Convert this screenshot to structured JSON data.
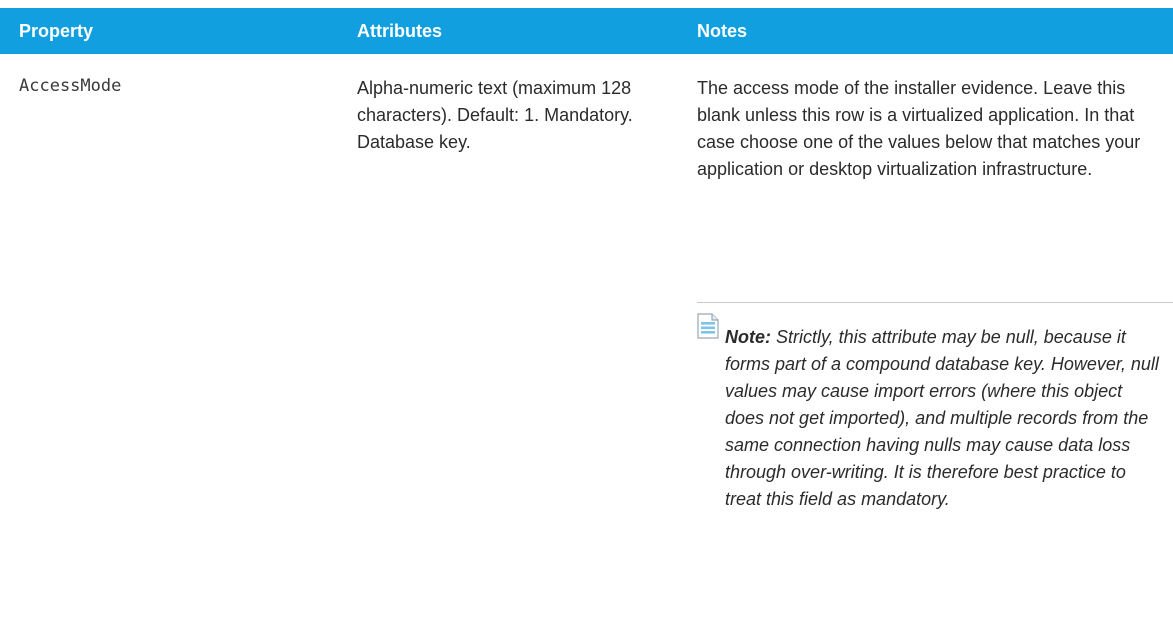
{
  "table": {
    "headers": {
      "property": "Property",
      "attributes": "Attributes",
      "notes": "Notes"
    },
    "rows": [
      {
        "property": "AccessMode",
        "attributes": "Alpha-numeric text (maximum 128 characters). Default: 1. Mandatory. Database key.",
        "notes": "The access mode of the installer evidence. Leave this blank unless this row is a virtualized application. In that case choose one of the values below that matches your application or desktop virtualization infrastructure.",
        "note": {
          "icon": "note-document-icon",
          "label": "Note:",
          "text": "Strictly, this attribute may be null, because it forms part of a compound database key. However, null values may cause import errors (where this object does not get imported), and multiple records from the same connection having nulls may cause data loss through over-writing. It is therefore best practice to treat this field as mandatory."
        }
      }
    ]
  },
  "colors": {
    "header_bg": "#119fe0",
    "header_text": "#ffffff",
    "body_text": "#2b2b2b",
    "note_icon": "#7ec4e8",
    "divider": "#c9c9c9"
  }
}
